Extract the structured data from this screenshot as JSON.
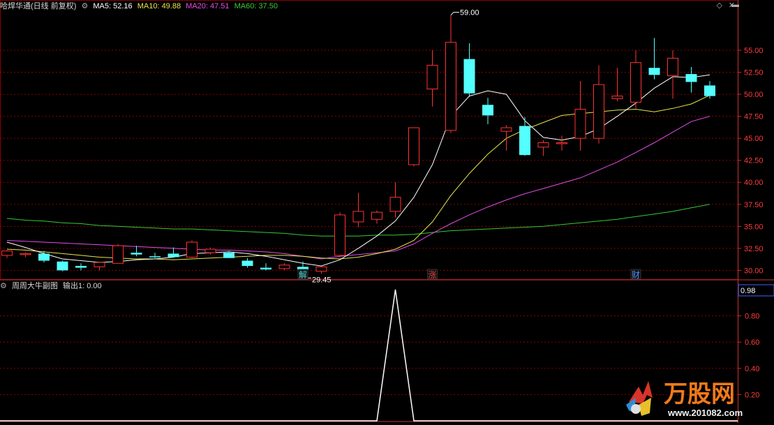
{
  "header": {
    "stock_title": "哈焊华通(日线 前复权)",
    "ma_labels": [
      {
        "text": "MA5: 52.16",
        "color": "#ffffff"
      },
      {
        "text": "MA10: 49.88",
        "color": "#e6e64c"
      },
      {
        "text": "MA20: 47.51",
        "color": "#e64ce6"
      },
      {
        "text": "MA60: 37.50",
        "color": "#36c936"
      }
    ]
  },
  "sub_header": {
    "indicator_name": "周周大牛副图",
    "output_text": "输出1: 0.00"
  },
  "markers": [
    {
      "text": "解",
      "color": "#4cd8d8",
      "index": 16
    },
    {
      "text": "涨",
      "color": "#e04040",
      "index": 23
    },
    {
      "text": "财",
      "color": "#4c8cff",
      "index": 34
    }
  ],
  "price_annotations": {
    "high_label": "59.00",
    "low_label": "29.45"
  },
  "watermark_text": "万股网",
  "watermark_url": "www.201082.com",
  "colors": {
    "up": "#ff3232",
    "down": "#54ffff",
    "grid": "#8b0000",
    "axis_text": "#ff3c3c",
    "ma5": "#ffffff",
    "ma10": "#e6e64c",
    "ma20": "#e64ce6",
    "ma60": "#36c936"
  },
  "chart_data": [
    {
      "type": "candlestick",
      "y_ticks": [
        "55.00",
        "52.50",
        "50.00",
        "47.50",
        "45.00",
        "42.50",
        "40.00",
        "37.50",
        "35.00",
        "32.50",
        "30.00"
      ],
      "ylim": [
        29.0,
        59.6
      ],
      "candles": [
        {
          "o": 31.7,
          "h": 32.3,
          "l": 31.4,
          "c": 32.2
        },
        {
          "o": 31.8,
          "h": 32.0,
          "l": 31.5,
          "c": 31.9
        },
        {
          "o": 31.9,
          "h": 32.2,
          "l": 30.9,
          "c": 31.1
        },
        {
          "o": 31.0,
          "h": 31.1,
          "l": 29.9,
          "c": 30.0
        },
        {
          "o": 30.5,
          "h": 30.8,
          "l": 30.0,
          "c": 30.3
        },
        {
          "o": 30.4,
          "h": 31.0,
          "l": 30.0,
          "c": 30.9
        },
        {
          "o": 30.8,
          "h": 33.0,
          "l": 30.8,
          "c": 32.8
        },
        {
          "o": 32.0,
          "h": 32.8,
          "l": 31.6,
          "c": 31.8
        },
        {
          "o": 31.6,
          "h": 32.0,
          "l": 31.4,
          "c": 31.5
        },
        {
          "o": 31.9,
          "h": 32.6,
          "l": 31.6,
          "c": 31.5
        },
        {
          "o": 31.5,
          "h": 33.4,
          "l": 31.4,
          "c": 33.2
        },
        {
          "o": 32.0,
          "h": 32.6,
          "l": 31.8,
          "c": 32.4
        },
        {
          "o": 32.0,
          "h": 32.2,
          "l": 31.4,
          "c": 31.4
        },
        {
          "o": 31.1,
          "h": 31.4,
          "l": 30.3,
          "c": 30.5
        },
        {
          "o": 30.3,
          "h": 30.8,
          "l": 30.0,
          "c": 30.1
        },
        {
          "o": 30.2,
          "h": 30.8,
          "l": 30.0,
          "c": 30.6
        },
        {
          "o": 30.4,
          "h": 31.0,
          "l": 29.45,
          "c": 30.1
        },
        {
          "o": 29.9,
          "h": 30.2,
          "l": 29.6,
          "c": 30.4
        },
        {
          "o": 31.7,
          "h": 36.6,
          "l": 31.5,
          "c": 36.3
        },
        {
          "o": 35.5,
          "h": 38.8,
          "l": 34.9,
          "c": 36.7
        },
        {
          "o": 35.8,
          "h": 36.8,
          "l": 35.3,
          "c": 36.6
        },
        {
          "o": 36.7,
          "h": 40.0,
          "l": 36.0,
          "c": 38.3
        },
        {
          "o": 42.0,
          "h": 46.2,
          "l": 41.8,
          "c": 46.2
        },
        {
          "o": 50.6,
          "h": 55.0,
          "l": 48.6,
          "c": 53.3
        },
        {
          "o": 45.9,
          "h": 59.0,
          "l": 45.6,
          "c": 55.9
        },
        {
          "o": 54.0,
          "h": 55.8,
          "l": 49.7,
          "c": 50.1
        },
        {
          "o": 48.8,
          "h": 49.6,
          "l": 46.6,
          "c": 47.6
        },
        {
          "o": 45.8,
          "h": 46.5,
          "l": 43.6,
          "c": 46.2
        },
        {
          "o": 46.4,
          "h": 47.4,
          "l": 43.0,
          "c": 43.1
        },
        {
          "o": 44.0,
          "h": 44.8,
          "l": 43.0,
          "c": 44.5
        },
        {
          "o": 44.5,
          "h": 45.3,
          "l": 43.6,
          "c": 44.5
        },
        {
          "o": 45.0,
          "h": 51.5,
          "l": 43.6,
          "c": 48.3
        },
        {
          "o": 45.0,
          "h": 53.3,
          "l": 44.4,
          "c": 51.1
        },
        {
          "o": 49.5,
          "h": 53.0,
          "l": 49.2,
          "c": 49.8
        },
        {
          "o": 49.1,
          "h": 55.0,
          "l": 48.4,
          "c": 53.6
        },
        {
          "o": 53.0,
          "h": 56.4,
          "l": 51.7,
          "c": 52.2
        },
        {
          "o": 52.1,
          "h": 55.0,
          "l": 49.5,
          "c": 54.1
        },
        {
          "o": 52.3,
          "h": 53.1,
          "l": 50.2,
          "c": 51.4
        },
        {
          "o": 51.0,
          "h": 51.5,
          "l": 49.5,
          "c": 49.8
        }
      ],
      "ma5": [
        33.2,
        32.6,
        31.9,
        31.3,
        31.1,
        30.9,
        31.0,
        31.2,
        31.3,
        31.5,
        31.9,
        32.0,
        32.1,
        31.9,
        31.6,
        31.2,
        30.8,
        30.5,
        31.2,
        32.5,
        33.9,
        35.6,
        38.3,
        42.0,
        47.5,
        49.8,
        50.4,
        50.0,
        47.0,
        45.1,
        44.8,
        45.2,
        46.1,
        47.5,
        49.0,
        50.7,
        52.0,
        51.9,
        52.2
      ],
      "ma10": [
        32.4,
        32.3,
        32.1,
        31.9,
        31.7,
        31.5,
        31.4,
        31.3,
        31.3,
        31.2,
        31.3,
        31.4,
        31.5,
        31.6,
        31.7,
        31.7,
        31.6,
        31.4,
        31.3,
        31.5,
        31.9,
        32.4,
        33.4,
        35.5,
        38.5,
        41.0,
        43.2,
        45.0,
        46.0,
        46.8,
        47.6,
        47.8,
        48.0,
        48.2,
        48.3,
        48.0,
        48.4,
        48.9,
        49.9
      ],
      "ma20": [
        33.4,
        33.3,
        33.2,
        33.1,
        33.0,
        32.9,
        32.8,
        32.7,
        32.6,
        32.5,
        32.4,
        32.3,
        32.3,
        32.2,
        32.1,
        31.9,
        31.6,
        31.3,
        31.6,
        31.8,
        32.0,
        32.2,
        33.0,
        34.2,
        35.3,
        36.3,
        37.2,
        38.0,
        38.7,
        39.3,
        39.9,
        40.5,
        41.4,
        42.3,
        43.4,
        44.5,
        45.7,
        46.9,
        47.5
      ],
      "ma60": [
        35.9,
        35.7,
        35.6,
        35.4,
        35.3,
        35.1,
        35.0,
        34.9,
        34.8,
        34.7,
        34.7,
        34.6,
        34.5,
        34.4,
        34.3,
        34.2,
        34.0,
        33.9,
        33.9,
        33.9,
        34.0,
        34.0,
        34.1,
        34.3,
        34.5,
        34.6,
        34.7,
        34.8,
        34.9,
        35.0,
        35.2,
        35.4,
        35.6,
        35.8,
        36.1,
        36.4,
        36.7,
        37.1,
        37.5
      ]
    },
    {
      "type": "line",
      "y_ticks": [
        "0.80",
        "0.60",
        "0.40",
        "0.20"
      ],
      "current_value_label": "0.98",
      "ylim": [
        0,
        1.0
      ],
      "values": [
        0,
        0,
        0,
        0,
        0,
        0,
        0,
        0,
        0,
        0,
        0,
        0,
        0,
        0,
        0,
        0,
        0,
        0,
        0,
        0,
        0,
        1,
        0,
        0,
        0,
        0,
        0,
        0,
        0,
        0,
        0,
        0,
        0,
        0,
        0,
        0,
        0,
        0,
        0
      ]
    }
  ]
}
